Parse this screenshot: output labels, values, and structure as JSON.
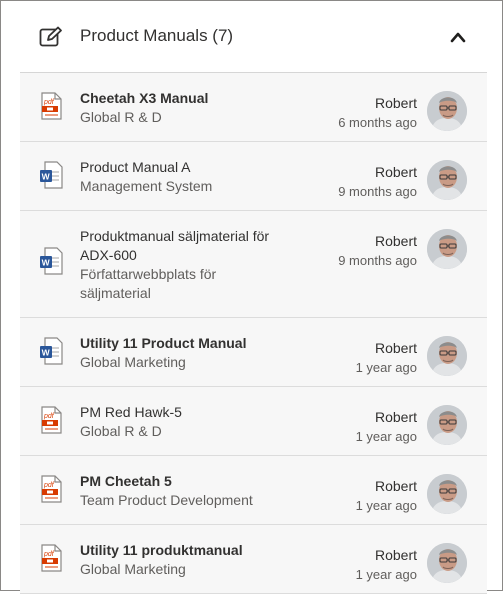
{
  "section": {
    "title": "Product Manuals (7)",
    "edit_icon": "edit-icon",
    "collapse_icon": "chevron-up-icon"
  },
  "items": [
    {
      "name": "Cheetah X3 Manual",
      "bold": true,
      "location": "Global R & D",
      "author": "Robert",
      "time": "6 months ago",
      "icon": "pdf-icon"
    },
    {
      "name": "Product Manual A",
      "bold": false,
      "location": "Management System",
      "author": "Robert",
      "time": "9 months ago",
      "icon": "word-icon"
    },
    {
      "name": "Produktmanual säljmaterial för ADX-600",
      "bold": false,
      "location": "Författarwebbplats för säljmaterial",
      "author": "Robert",
      "time": "9 months ago",
      "icon": "word-icon"
    },
    {
      "name": "Utility 11 Product Manual",
      "bold": true,
      "location": "Global Marketing",
      "author": "Robert",
      "time": "1 year ago",
      "icon": "word-icon"
    },
    {
      "name": "PM Red Hawk-5",
      "bold": false,
      "location": "Global R & D",
      "author": "Robert",
      "time": "1 year ago",
      "icon": "pdf-icon"
    },
    {
      "name": "PM Cheetah 5",
      "bold": true,
      "location": "Team Product Development",
      "author": "Robert",
      "time": "1 year ago",
      "icon": "pdf-icon"
    },
    {
      "name": "Utility 11 produktmanual",
      "bold": true,
      "location": "Global Marketing",
      "author": "Robert",
      "time": "1 year ago",
      "icon": "pdf-icon"
    }
  ],
  "colors": {
    "pdf": "#d83b01",
    "word": "#2b579a",
    "divider": "#dcdcdc",
    "row_bg": "#f7f7f7"
  }
}
